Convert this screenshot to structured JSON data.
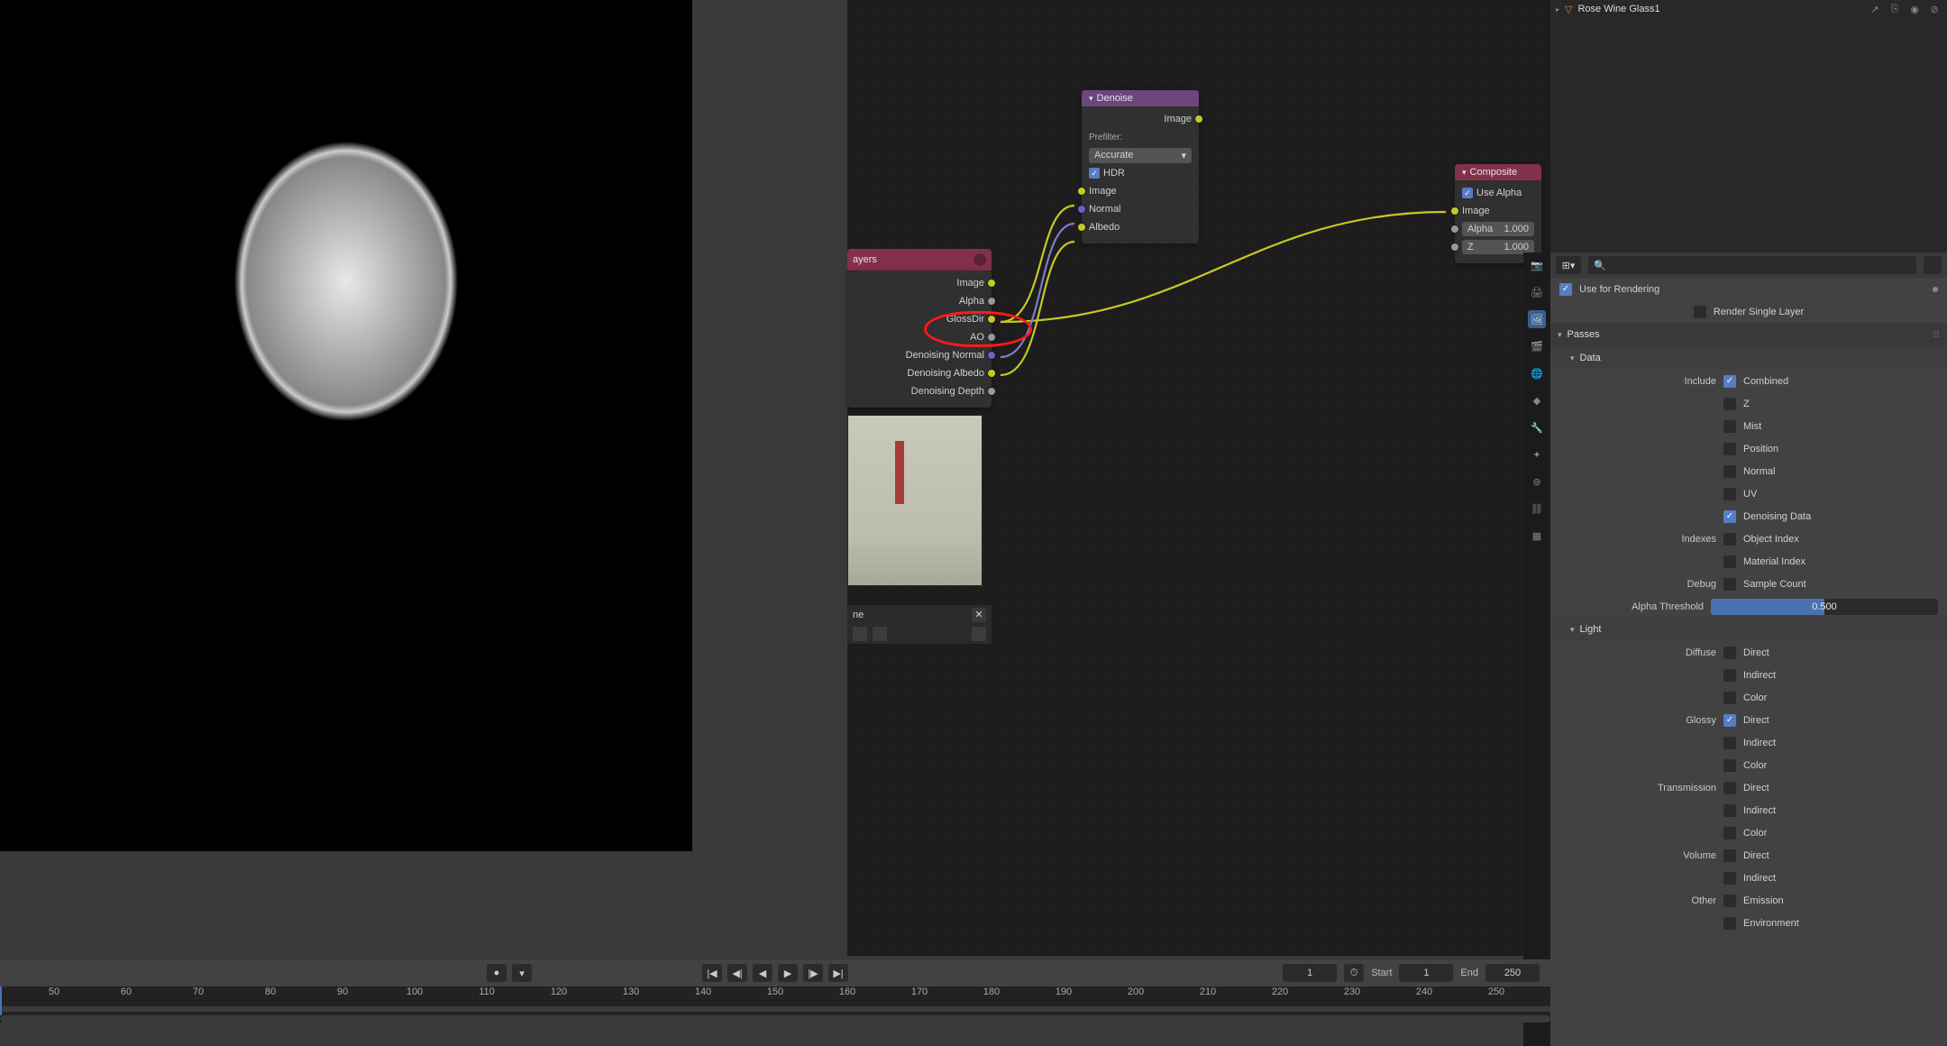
{
  "outliner": {
    "object_name": "Rose Wine Glass1"
  },
  "nodes": {
    "layers_header": "ayers",
    "layers_outputs": [
      "Image",
      "Alpha",
      "GlossDir",
      "AO",
      "Denoising Normal",
      "Denoising Albedo",
      "Denoising Depth"
    ],
    "denoise": {
      "title": "Denoise",
      "out": "Image",
      "prefilter_label": "Prefilter:",
      "prefilter_value": "Accurate",
      "hdr_label": "HDR",
      "inputs": [
        "Image",
        "Normal",
        "Albedo"
      ]
    },
    "composite": {
      "title": "Composite",
      "use_alpha": "Use Alpha",
      "inputs": [
        {
          "name": "Image",
          "val": ""
        },
        {
          "name": "Alpha",
          "val": "1.000"
        },
        {
          "name": "Z",
          "val": "1.000"
        }
      ]
    },
    "scene_name": "ne"
  },
  "props": {
    "use_for_rendering": "Use for Rendering",
    "render_single_layer": "Render Single Layer",
    "passes": "Passes",
    "data": "Data",
    "include_label": "Include",
    "include": [
      {
        "name": "Combined",
        "on": true
      },
      {
        "name": "Z",
        "on": false
      },
      {
        "name": "Mist",
        "on": false
      },
      {
        "name": "Position",
        "on": false
      },
      {
        "name": "Normal",
        "on": false
      },
      {
        "name": "UV",
        "on": false
      },
      {
        "name": "Denoising Data",
        "on": true
      }
    ],
    "indexes_label": "Indexes",
    "indexes": [
      {
        "name": "Object Index",
        "on": false
      },
      {
        "name": "Material Index",
        "on": false
      }
    ],
    "debug_label": "Debug",
    "debug": [
      {
        "name": "Sample Count",
        "on": false
      }
    ],
    "alpha_threshold_label": "Alpha Threshold",
    "alpha_threshold_value": "0.500",
    "light": "Light",
    "diffuse_label": "Diffuse",
    "diffuse": [
      {
        "name": "Direct",
        "on": false
      },
      {
        "name": "Indirect",
        "on": false
      },
      {
        "name": "Color",
        "on": false
      }
    ],
    "glossy_label": "Glossy",
    "glossy": [
      {
        "name": "Direct",
        "on": true
      },
      {
        "name": "Indirect",
        "on": false
      },
      {
        "name": "Color",
        "on": false
      }
    ],
    "transmission_label": "Transmission",
    "transmission": [
      {
        "name": "Direct",
        "on": false
      },
      {
        "name": "Indirect",
        "on": false
      },
      {
        "name": "Color",
        "on": false
      }
    ],
    "volume_label": "Volume",
    "volume": [
      {
        "name": "Direct",
        "on": false
      },
      {
        "name": "Indirect",
        "on": false
      }
    ],
    "other_label": "Other",
    "other": [
      {
        "name": "Emission",
        "on": false
      },
      {
        "name": "Environment",
        "on": false
      }
    ]
  },
  "timeline": {
    "current": "1",
    "start_label": "Start",
    "start": "1",
    "end_label": "End",
    "end": "250",
    "ticks": [
      50,
      60,
      70,
      80,
      90,
      100,
      110,
      120,
      130,
      140,
      150,
      160,
      170,
      180,
      190,
      200,
      210,
      220,
      230,
      240,
      250
    ]
  }
}
